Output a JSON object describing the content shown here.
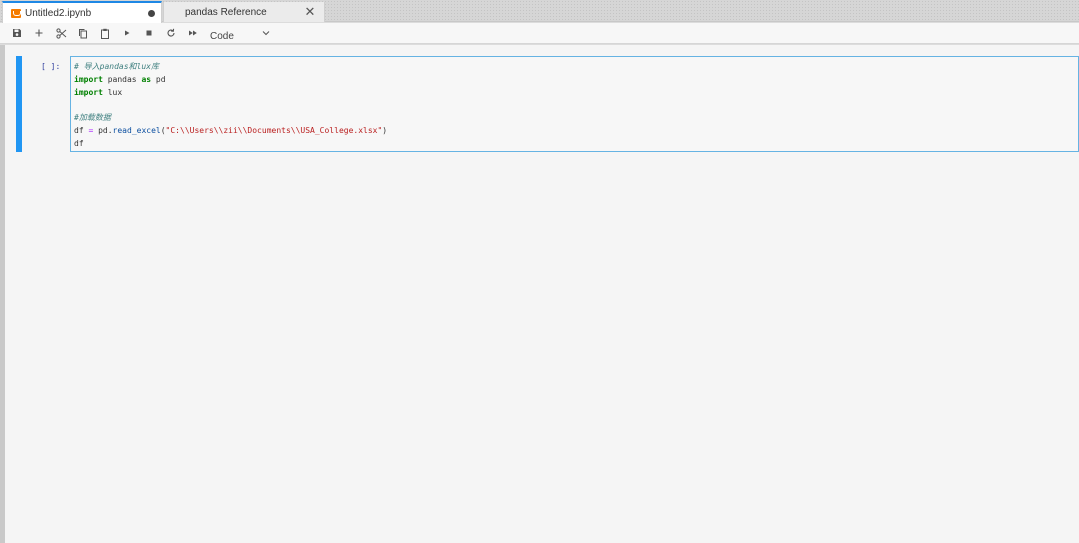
{
  "tabs": [
    {
      "label": "Untitled2.ipynb",
      "active": true,
      "dirty": true
    },
    {
      "label": "pandas Reference",
      "active": false
    }
  ],
  "toolbar": {
    "buttons": [
      "save-icon",
      "add-icon",
      "cut-icon",
      "copy-icon",
      "paste-icon",
      "run-icon",
      "stop-icon",
      "restart-icon",
      "fast-forward-icon"
    ],
    "cell_type": "Code"
  },
  "cell": {
    "prompt": "[ ]:",
    "lines": {
      "l1": {
        "comment": "# 导入pandas和lux库"
      },
      "l2": {
        "kw1": "import",
        "t1": " pandas ",
        "kw2": "as",
        "t2": " pd"
      },
      "l3": {
        "kw1": "import",
        "t1": " lux"
      },
      "l4": {},
      "l5": {
        "comment": "#加载数据"
      },
      "l6": {
        "t1": "df ",
        "op": "=",
        "t2": " pd.",
        "fn": "read_excel",
        "t3": "(",
        "str": "\"C:\\\\Users\\\\zii\\\\Documents\\\\USA_College.xlsx\"",
        "t4": ")"
      },
      "l7": {
        "t1": "df"
      }
    }
  },
  "colors": {
    "accent": "#2196f3",
    "keyword": "#008000",
    "string": "#ba2121",
    "comment": "#408080",
    "dirty_dot": "#444444"
  }
}
